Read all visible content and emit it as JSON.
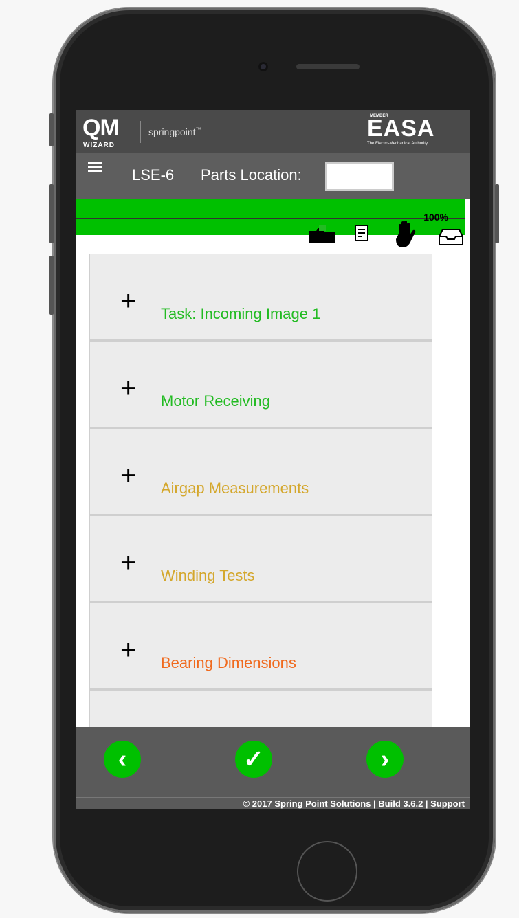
{
  "header": {
    "app_logo": "QM",
    "app_logo_sub": "WIZARD",
    "partner": "springpoint",
    "partner_tm": "™",
    "easa_member": "MEMBER",
    "easa_logo": "EASA",
    "easa_tagline": "The Electro-Mechanical Authority"
  },
  "nav": {
    "job_number": "LSE-6",
    "parts_location_label": "Parts Location:",
    "parts_location_value": ""
  },
  "progress": {
    "percent_text": "100%",
    "fraction": 1.0,
    "color": "#00c000"
  },
  "toolbar_icons": [
    "folder-icon",
    "document-icon",
    "hand-stop-icon",
    "inbox-icon"
  ],
  "tasks": [
    {
      "label": "Task: Incoming Image 1",
      "color": "#22bb22"
    },
    {
      "label": "Motor Receiving",
      "color": "#22bb22"
    },
    {
      "label": "Airgap Measurements",
      "color": "#d4a72c"
    },
    {
      "label": "Winding Tests",
      "color": "#d4a72c"
    },
    {
      "label": "Bearing Dimensions",
      "color": "#f06a1e"
    }
  ],
  "expand_symbol": "+",
  "footer": {
    "text": "© 2017 Spring Point Solutions  | Build 3.6.2 | Support"
  },
  "actions": {
    "prev": "‹",
    "done": "✓",
    "next": "›"
  }
}
